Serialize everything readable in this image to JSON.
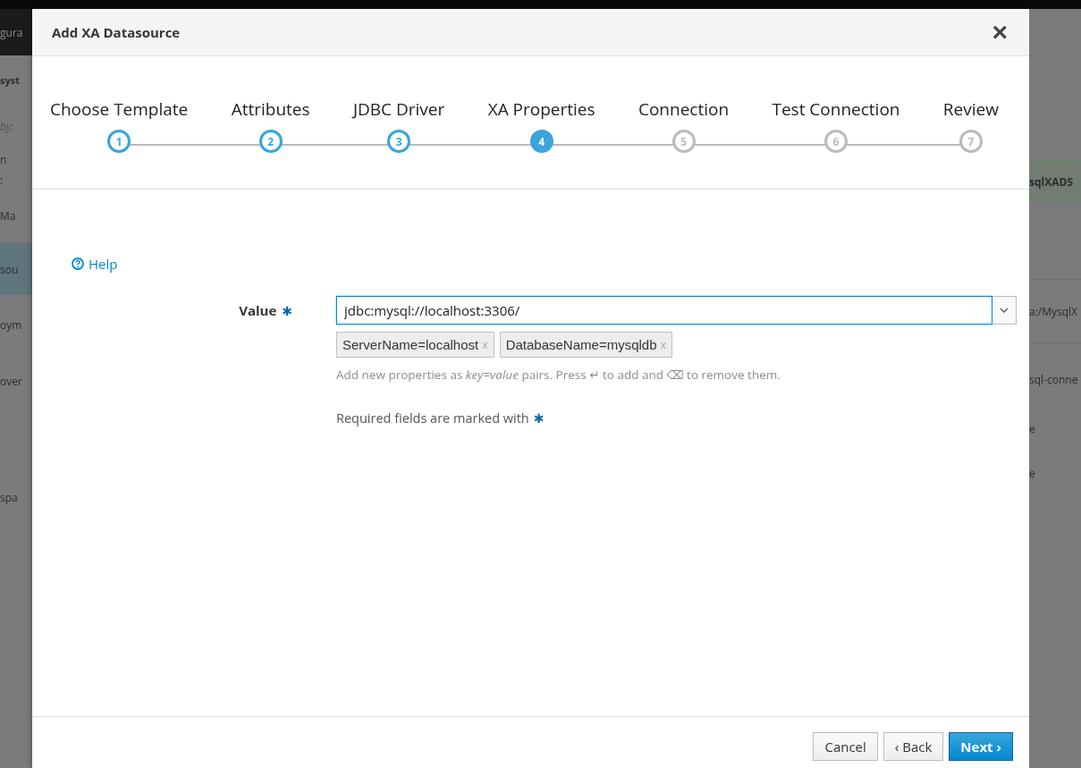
{
  "background": {
    "left_items": [
      {
        "text": "gura",
        "kind": "header"
      },
      {
        "text": "syst",
        "kind": "title"
      },
      {
        "text": "by:",
        "kind": "filter"
      },
      {
        "text": "n",
        "kind": "plain"
      },
      {
        "text": ":",
        "kind": "plain"
      },
      {
        "text": "Ma",
        "kind": "plain"
      },
      {
        "text": "sou",
        "kind": "active"
      },
      {
        "text": "oym",
        "kind": "plain"
      },
      {
        "text": "over",
        "kind": "plain"
      },
      {
        "text": "spa",
        "kind": "plain"
      }
    ],
    "right_items": [
      {
        "text": "sqlXADS",
        "kind": "title"
      },
      {
        "text": "a:/MysqlX",
        "kind": "plain"
      },
      {
        "text": "sql-conne",
        "kind": "plain"
      },
      {
        "text": "e",
        "kind": "plain"
      },
      {
        "text": "e",
        "kind": "plain"
      }
    ]
  },
  "dialog": {
    "title": "Add XA Datasource",
    "close": "×",
    "steps": [
      {
        "label": "Choose Template",
        "number": "1",
        "done": true,
        "selected": false
      },
      {
        "label": "Attributes",
        "number": "2",
        "done": true,
        "selected": false
      },
      {
        "label": "JDBC Driver",
        "number": "3",
        "done": true,
        "selected": false
      },
      {
        "label": "XA Properties",
        "number": "4",
        "done": false,
        "selected": true
      },
      {
        "label": "Connection",
        "number": "5",
        "done": false,
        "selected": false
      },
      {
        "label": "Test Connection",
        "number": "6",
        "done": false,
        "selected": false
      },
      {
        "label": "Review",
        "number": "7",
        "done": false,
        "selected": false
      }
    ],
    "help_link": "Help",
    "field": {
      "label": "Value",
      "required_mark": "✱",
      "value": "jdbc:mysql://localhost:3306/",
      "tags": [
        {
          "text": "ServerName=localhost",
          "remove": "x"
        },
        {
          "text": "DatabaseName=mysqldb",
          "remove": "x"
        }
      ],
      "hint": "Add new properties as *key=value* pairs. Press ↵ to add and ⌫ to remove them."
    },
    "required_note": "Required fields are marked with",
    "required_note_mark": "✱",
    "buttons": [
      {
        "label": "Cancel",
        "kind": "default"
      },
      {
        "label": "‹ Back",
        "kind": "default"
      },
      {
        "label": "Next ›",
        "kind": "primary"
      }
    ]
  }
}
